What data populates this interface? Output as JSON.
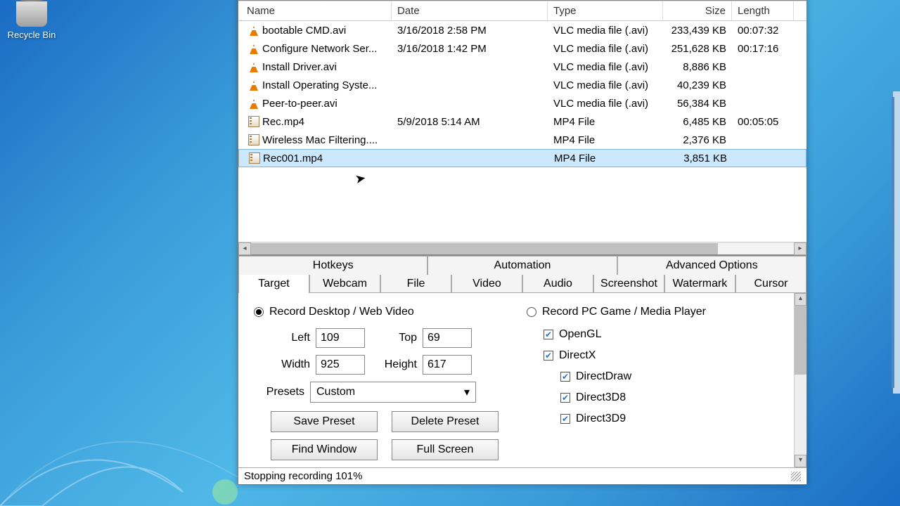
{
  "desktop": {
    "recycle_bin": "Recycle Bin"
  },
  "columns": {
    "name": "Name",
    "date": "Date",
    "type": "Type",
    "size": "Size",
    "length": "Length"
  },
  "files": [
    {
      "icon": "vlc",
      "name": "bootable CMD.avi",
      "date": "3/16/2018 2:58 PM",
      "type": "VLC media file (.avi)",
      "size": "233,439 KB",
      "length": "00:07:32"
    },
    {
      "icon": "vlc",
      "name": "Configure Network Ser...",
      "date": "3/16/2018 1:42 PM",
      "type": "VLC media file (.avi)",
      "size": "251,628 KB",
      "length": "00:17:16"
    },
    {
      "icon": "vlc",
      "name": "Install Driver.avi",
      "date": "",
      "type": "VLC media file (.avi)",
      "size": "8,886 KB",
      "length": ""
    },
    {
      "icon": "vlc",
      "name": "Install Operating Syste...",
      "date": "",
      "type": "VLC media file (.avi)",
      "size": "40,239 KB",
      "length": ""
    },
    {
      "icon": "vlc",
      "name": "Peer-to-peer.avi",
      "date": "",
      "type": "VLC media file (.avi)",
      "size": "56,384 KB",
      "length": ""
    },
    {
      "icon": "mp4",
      "name": "Rec.mp4",
      "date": "5/9/2018 5:14 AM",
      "type": "MP4 File",
      "size": "6,485 KB",
      "length": "00:05:05"
    },
    {
      "icon": "mp4",
      "name": "Wireless Mac Filtering....",
      "date": "",
      "type": "MP4 File",
      "size": "2,376 KB",
      "length": ""
    },
    {
      "icon": "mp4",
      "name": "Rec001.mp4",
      "date": "",
      "type": "MP4 File",
      "size": "3,851 KB",
      "length": "",
      "selected": true
    }
  ],
  "tabs_top": [
    "Hotkeys",
    "Automation",
    "Advanced Options"
  ],
  "tabs_bottom": [
    "Target",
    "Webcam",
    "File",
    "Video",
    "Audio",
    "Screenshot",
    "Watermark",
    "Cursor"
  ],
  "active_tab": "Target",
  "target": {
    "record_desktop": "Record Desktop / Web Video",
    "record_game": "Record PC Game / Media Player",
    "left_lbl": "Left",
    "left_val": "109",
    "top_lbl": "Top",
    "top_val": "69",
    "width_lbl": "Width",
    "width_val": "925",
    "height_lbl": "Height",
    "height_val": "617",
    "presets_lbl": "Presets",
    "presets_val": "Custom",
    "save_preset": "Save Preset",
    "delete_preset": "Delete Preset",
    "find_window": "Find Window",
    "full_screen": "Full Screen",
    "opengl": "OpenGL",
    "directx": "DirectX",
    "directdraw": "DirectDraw",
    "d3d8": "Direct3D8",
    "d3d9": "Direct3D9"
  },
  "status": "Stopping recording 101%"
}
